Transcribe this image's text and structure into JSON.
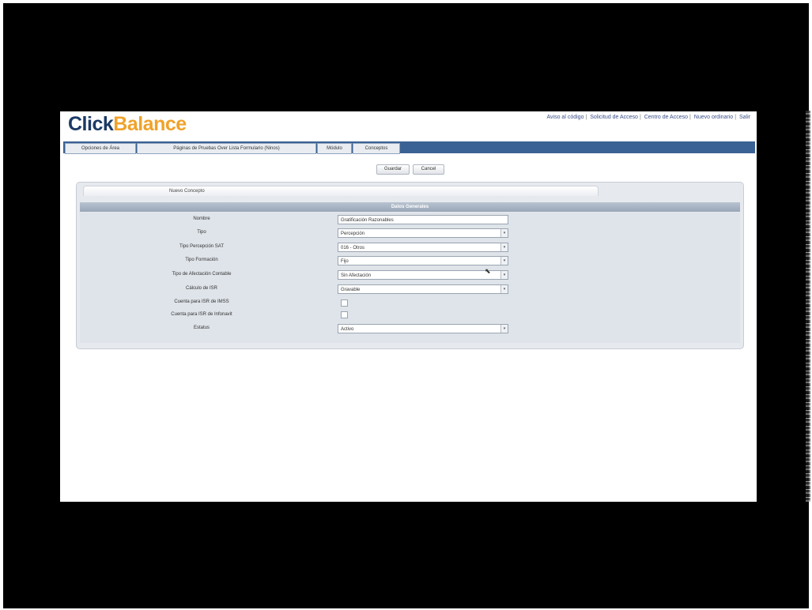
{
  "header": {
    "logo_part1": "Click",
    "logo_part2": "Balance",
    "links": [
      "Aviso al código",
      "Solicitud de Acceso",
      "Centro de Acceso",
      "Nuevo ordinario",
      "Salir"
    ]
  },
  "nav": {
    "tabs": [
      "Opciones de Área",
      "Páginas de Pruebas Over Lista Formulario (Ninos)",
      "Módulo",
      "Conceptos"
    ]
  },
  "toolbar": {
    "save_label": "Guardar",
    "cancel_label": "Cancel"
  },
  "panel": {
    "tab_label": "Nuevo Concepto",
    "section_title": "Datos Generales",
    "fields": {
      "nombre_label": "Nombre",
      "nombre_value": "Gratificación Razonables",
      "tipo_label": "Tipo",
      "tipo_value": "Percepción",
      "tipo_percepcion_sat_label": "Tipo Percepción SAT",
      "tipo_percepcion_sat_value": "016 - Otros",
      "tipo_formacion_label": "Tipo Formación",
      "tipo_formacion_value": "Fijo",
      "tipo_afectacion_label": "Tipo de Afectación Contable",
      "tipo_afectacion_value": "Sin Afectación",
      "calculo_isr_label": "Cálculo de ISR",
      "calculo_isr_value": "Gravable",
      "cuenta_isr_imss_label": "Cuenta para ISR de IMSS",
      "cuenta_isr_infonavit_label": "Cuenta para ISR de Infonavit",
      "estatus_label": "Estatus",
      "estatus_value": "Activo"
    }
  }
}
